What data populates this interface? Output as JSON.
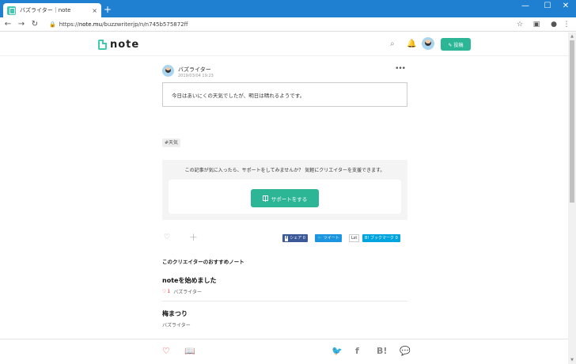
{
  "browser": {
    "tab_title": "バズライター｜note",
    "tab_close": "×",
    "new_tab": "+",
    "minimize": "—",
    "maximize": "☐",
    "close": "✕",
    "back": "←",
    "forward": "→",
    "reload": "↻",
    "url_scheme": "https://",
    "url_host": "note.mu",
    "url_path": "/buzzwriterjp/n/n745b575872ff",
    "bookmark": "☆",
    "menu": "⋮"
  },
  "header": {
    "logo_text": "note",
    "post_label": "✎ 投稿"
  },
  "article": {
    "author_name": "バズライター",
    "date": "2019/03/04 19:23",
    "more": "•••",
    "body": "今日はあいにくの天気でしたが、明日は晴れるようです。",
    "hashtag": "#天気"
  },
  "support": {
    "message": "この記事が気に入ったら、サポートをしてみませんか？ 気軽にクリエイターを支援できます。",
    "button_label": "サポートをする"
  },
  "actions": {
    "like_icon": "♡",
    "plus_icon": "+",
    "facebook_label": "シェア 0",
    "facebook_icon": "f",
    "twitter_label": "🐦 ツイート",
    "count_label": "Lst",
    "hatena_label": "B! ブックマーク 0"
  },
  "recommend": {
    "heading": "このクリエイターのおすすめノート",
    "items": [
      {
        "title": "noteを始めました",
        "likes": "1",
        "author": "バズライター"
      },
      {
        "title": "梅まつり",
        "author": "バズライター"
      }
    ]
  },
  "bottom_bar": {
    "like": "♡",
    "magazine": "📖",
    "twitter": "🐦",
    "facebook": "f",
    "hatena": "B!",
    "line": "💬"
  },
  "colors": {
    "accent": "#2cb696",
    "browser_bar": "#1f7fd1",
    "heart": "#e33333"
  }
}
